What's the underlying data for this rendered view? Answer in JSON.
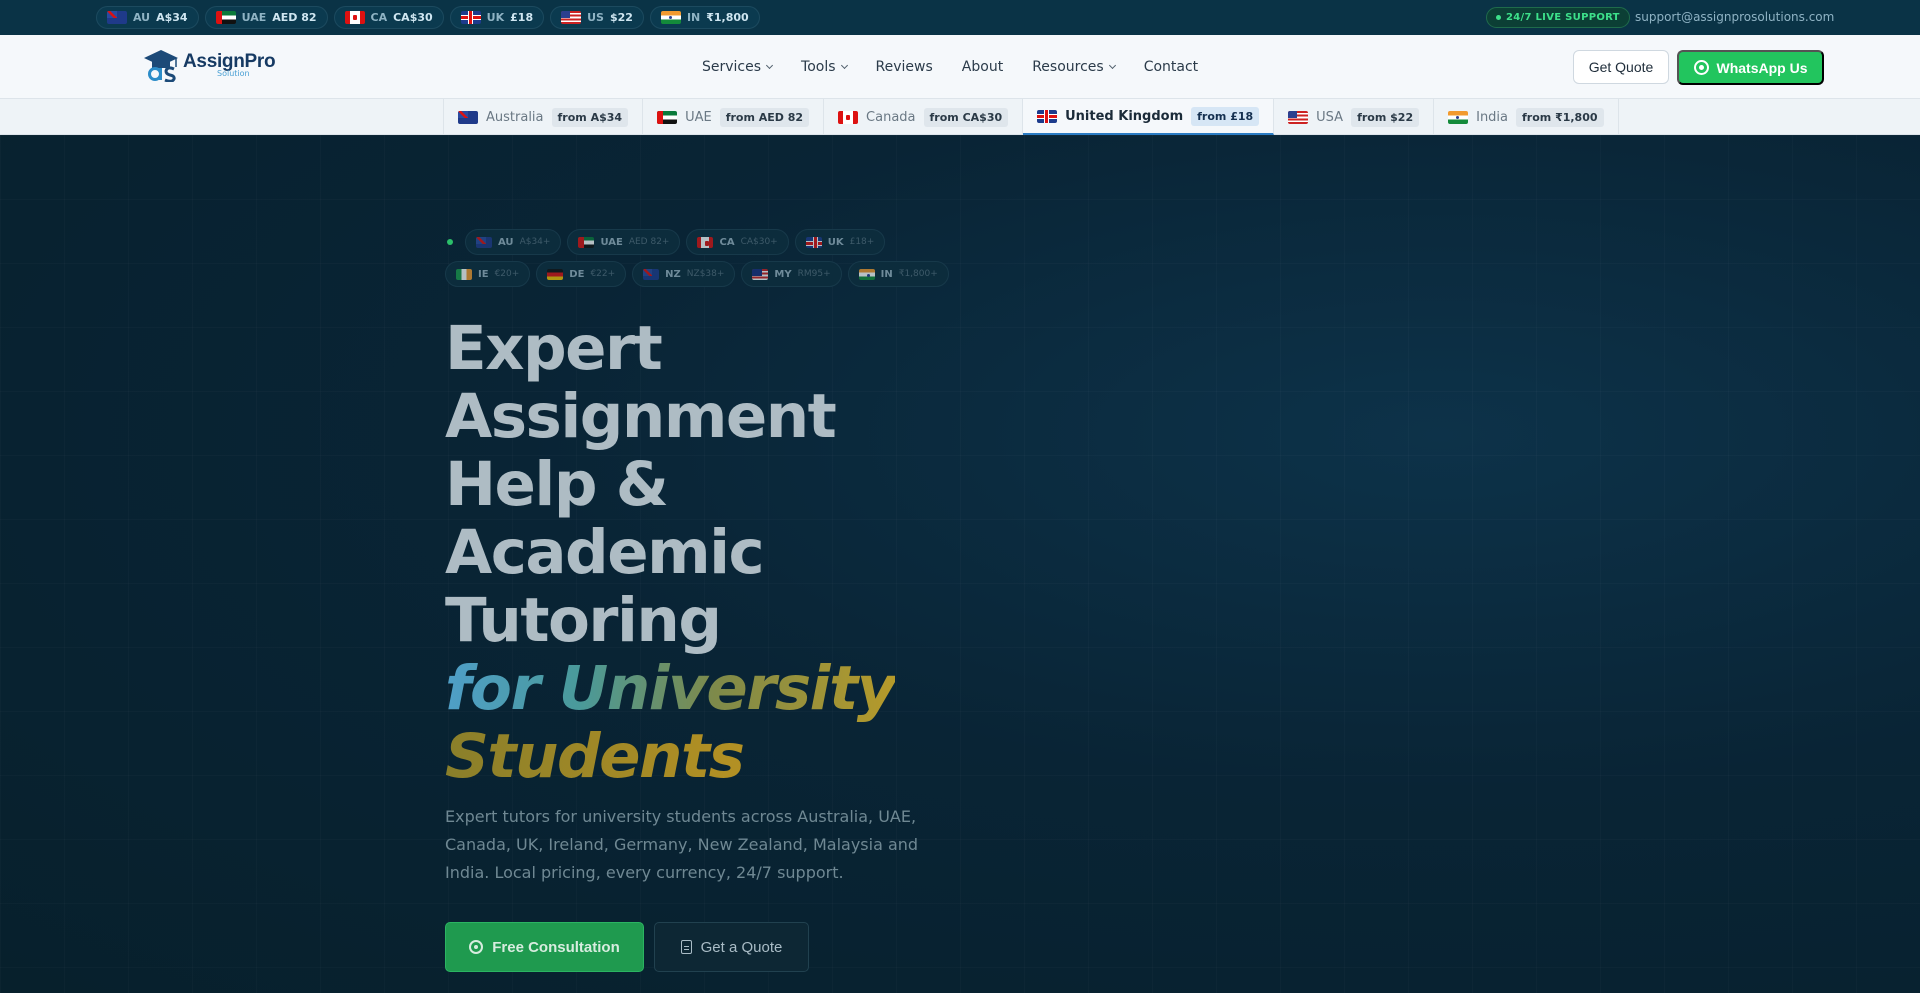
{
  "topbar": {
    "pills": [
      {
        "flag": "f-au",
        "code": "AU",
        "price": "A$34"
      },
      {
        "flag": "f-ae",
        "code": "UAE",
        "price": "AED 82"
      },
      {
        "flag": "f-ca",
        "code": "CA",
        "price": "CA$30"
      },
      {
        "flag": "f-uk",
        "code": "UK",
        "price": "£18"
      },
      {
        "flag": "f-us",
        "code": "US",
        "price": "$22"
      },
      {
        "flag": "f-in",
        "code": "IN",
        "price": "₹1,800"
      }
    ],
    "support_badge": "24/7 LIVE SUPPORT",
    "support_email": "support@assignprosolutions.com"
  },
  "header": {
    "logo_name": "AssignPro",
    "logo_sub": "Solution",
    "nav": [
      {
        "label": "Services",
        "dropdown": true
      },
      {
        "label": "Tools",
        "dropdown": true
      },
      {
        "label": "Reviews",
        "dropdown": false
      },
      {
        "label": "About",
        "dropdown": false
      },
      {
        "label": "Resources",
        "dropdown": true
      },
      {
        "label": "Contact",
        "dropdown": false
      }
    ],
    "quote_button": "Get Quote",
    "whatsapp_button": "WhatsApp Us"
  },
  "country_tabs": [
    {
      "flag": "f-au",
      "name": "Australia",
      "from": "from A$34",
      "active": false
    },
    {
      "flag": "f-ae",
      "name": "UAE",
      "from": "from AED 82",
      "active": false
    },
    {
      "flag": "f-ca",
      "name": "Canada",
      "from": "from CA$30",
      "active": false
    },
    {
      "flag": "f-uk",
      "name": "United Kingdom",
      "from": "from £18",
      "active": true
    },
    {
      "flag": "f-us",
      "name": "USA",
      "from": "from $22",
      "active": false
    },
    {
      "flag": "f-in",
      "name": "India",
      "from": "from ₹1,800",
      "active": false
    }
  ],
  "hero": {
    "chips": [
      {
        "flag": "f-au",
        "code": "AU",
        "price": "A$34+"
      },
      {
        "flag": "f-ae",
        "code": "UAE",
        "price": "AED 82+"
      },
      {
        "flag": "f-ca",
        "code": "CA",
        "price": "CA$30+"
      },
      {
        "flag": "f-uk",
        "code": "UK",
        "price": "£18+"
      },
      {
        "flag": "f-ie",
        "code": "IE",
        "price": "€20+"
      },
      {
        "flag": "f-de",
        "code": "DE",
        "price": "€22+"
      },
      {
        "flag": "f-nz",
        "code": "NZ",
        "price": "NZ$38+"
      },
      {
        "flag": "f-my",
        "code": "MY",
        "price": "RM95+"
      },
      {
        "flag": "f-in",
        "code": "IN",
        "price": "₹1,800+"
      }
    ],
    "title_lines": [
      "Expert",
      "Assignment",
      "Help &",
      "Academic",
      "Tutoring"
    ],
    "title_accent_1": "for University",
    "title_accent_2": "Students",
    "subtitle": "Expert tutors for university students across Australia, UAE, Canada, UK, Ireland, Germany, New Zealand, Malaysia and India. Local pricing, every currency, 24/7 support.",
    "cta_primary": "Free Consultation",
    "cta_secondary": "Get a Quote"
  }
}
